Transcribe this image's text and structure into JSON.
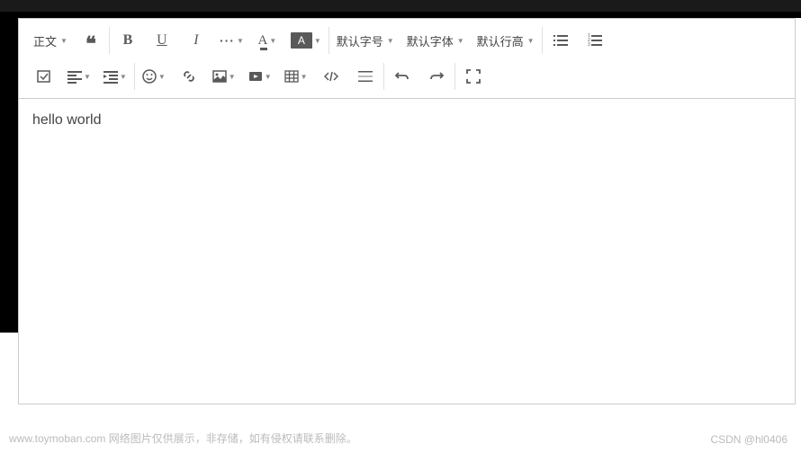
{
  "browser": {
    "url_fragment": "······· / ·······················"
  },
  "toolbar": {
    "heading_label": "正文",
    "font_size_label": "默认字号",
    "font_family_label": "默认字体",
    "line_height_label": "默认行高",
    "more_dots": "···",
    "font_color_letter": "A",
    "bg_color_letter": "A",
    "bold_letter": "B",
    "underline_letter": "U",
    "italic_letter": "I"
  },
  "content": {
    "text": "hello world"
  },
  "footer": {
    "left": "www.toymoban.com 网络图片仅供展示，非存储，如有侵权请联系删除。",
    "right": "CSDN @hl0406"
  }
}
